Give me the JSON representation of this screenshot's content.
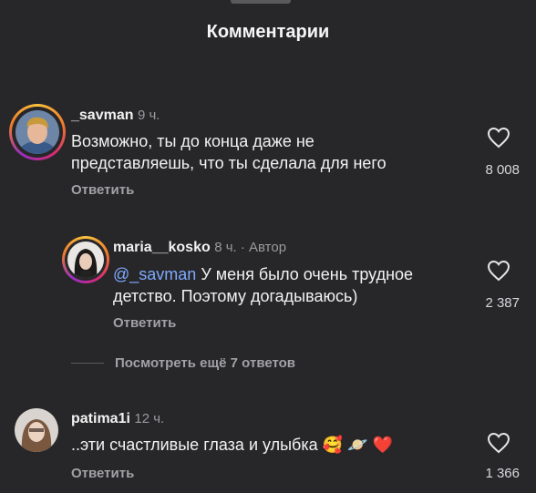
{
  "header": {
    "title": "Комментарии"
  },
  "comments": [
    {
      "username": "_savman",
      "time": "9 ч.",
      "text_line1": "Возможно, ты до конца даже не",
      "text_line2": "представляешь, что ты сделала для него",
      "reply_label": "Ответить",
      "likes": "8 008"
    },
    {
      "username": "maria__kosko",
      "time_author": "8 ч. · Автор",
      "mention": "@_savman",
      "text_line1_rest": " У меня было очень трудное",
      "text_line2": "детство. Поэтому догадываюсь)",
      "reply_label": "Ответить",
      "likes": "2 387"
    },
    {
      "username": "patima1i",
      "time": "12 ч.",
      "text": "..эти счастливые глаза и улыбка",
      "emojis": [
        "🥰",
        "🪐",
        "❤️"
      ],
      "reply_label": "Ответить",
      "likes": "1 366"
    }
  ],
  "view_more": "Посмотреть ещё 7 ответов",
  "icons": {
    "like": "heart-outline-icon"
  },
  "colors": {
    "background": "#272729",
    "mention": "#7ea8ff"
  }
}
